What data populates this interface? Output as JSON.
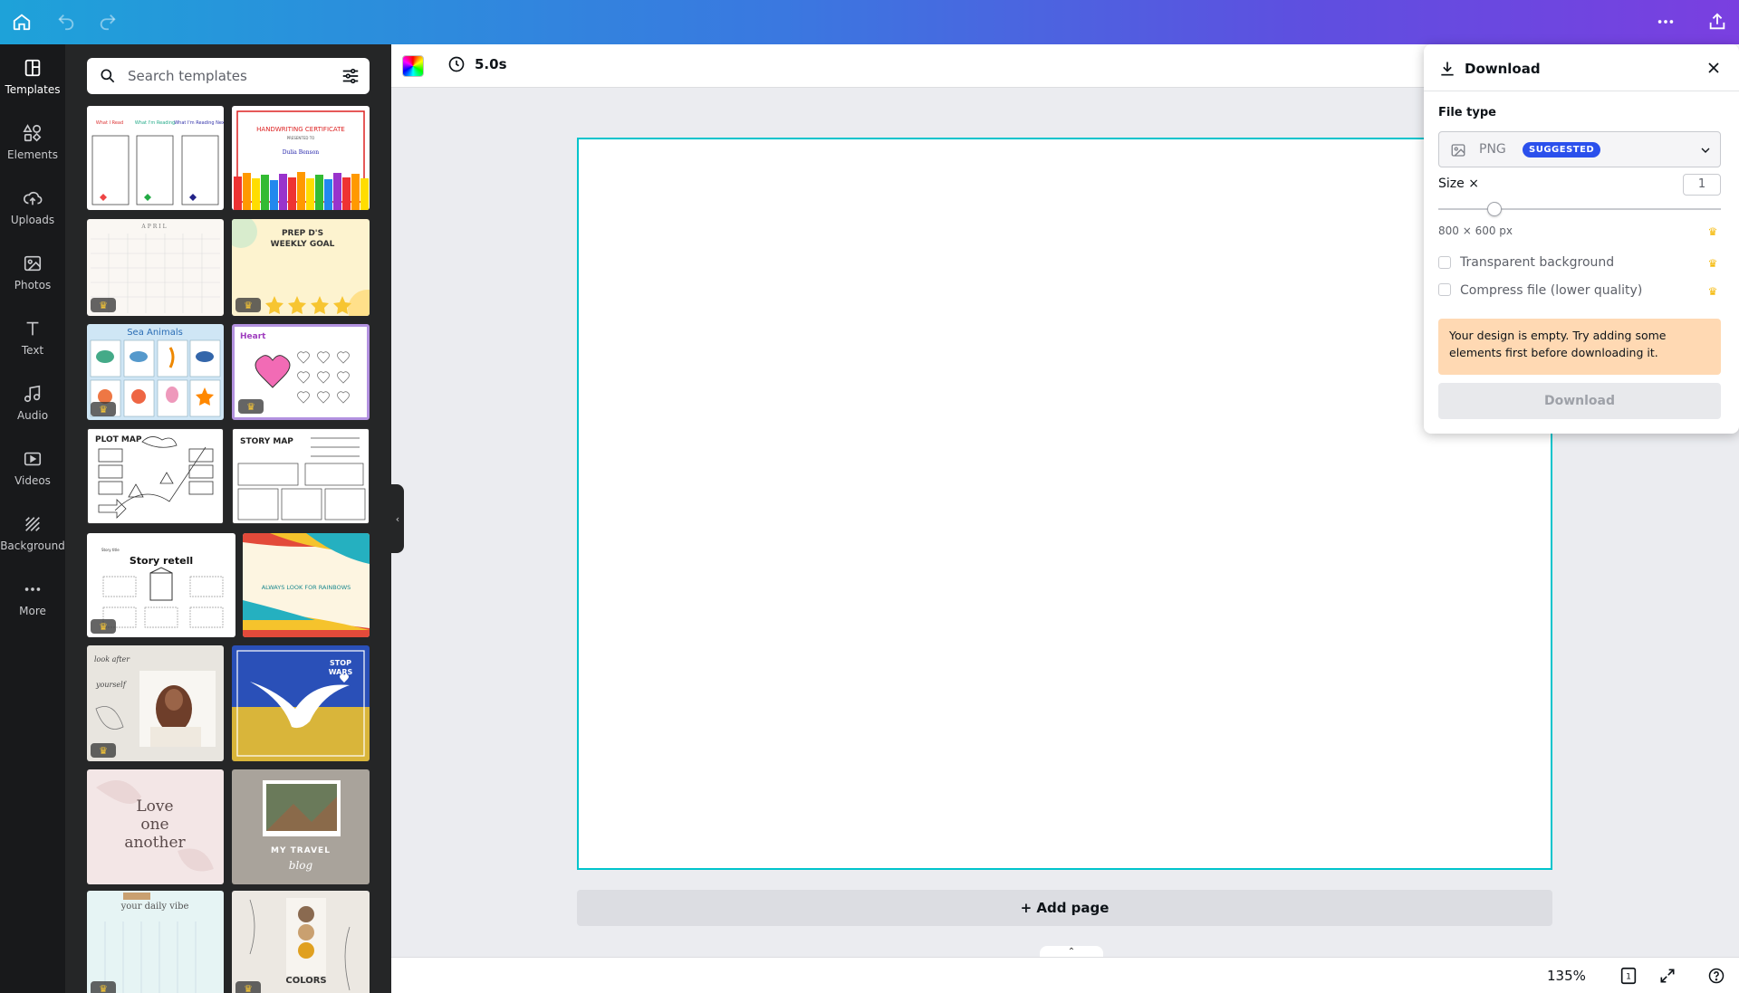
{
  "topbar": {
    "home_icon": "home-icon",
    "undo_icon": "undo-icon",
    "redo_icon": "redo-icon",
    "more_icon": "more-dots-icon",
    "share_icon": "share-export-icon"
  },
  "rail": {
    "items": [
      {
        "label": "Templates",
        "icon": "templates-icon",
        "active": true
      },
      {
        "label": "Elements",
        "icon": "elements-icon"
      },
      {
        "label": "Uploads",
        "icon": "upload-cloud-icon"
      },
      {
        "label": "Photos",
        "icon": "photos-icon"
      },
      {
        "label": "Text",
        "icon": "text-icon"
      },
      {
        "label": "Audio",
        "icon": "music-note-icon"
      },
      {
        "label": "Videos",
        "icon": "video-icon"
      },
      {
        "label": "Background",
        "icon": "background-pattern-icon"
      },
      {
        "label": "More",
        "icon": "more-dots-icon"
      }
    ]
  },
  "panel": {
    "search_placeholder": "Search templates",
    "templates": [
      {
        "name": "reading-log"
      },
      {
        "name": "handwriting-certificate",
        "text": "HANDWRITING CERTIFICATE"
      },
      {
        "name": "april-calendar",
        "text": "APRIL",
        "premium": true
      },
      {
        "name": "weekly-goal",
        "text": "PREP D'S WEEKLY GOAL",
        "premium": true
      },
      {
        "name": "sea-animals",
        "text": "Sea Animals",
        "premium": true
      },
      {
        "name": "heart-worksheet",
        "text": "Heart",
        "premium": true
      },
      {
        "name": "plot-map",
        "text": "PLOT MAP"
      },
      {
        "name": "story-map",
        "text": "STORY MAP"
      },
      {
        "name": "story-retell",
        "text": "Story retell",
        "premium": true
      },
      {
        "name": "rainbow",
        "text": "ALWAYS LOOK FOR RAINBOWS"
      },
      {
        "name": "look-after-yourself",
        "text": "look after yourself",
        "premium": true
      },
      {
        "name": "stop-wars",
        "text": "STOP WARS"
      },
      {
        "name": "love-one-another",
        "text": "Love one another"
      },
      {
        "name": "travel-blog",
        "text": "MY TRAVEL blog"
      },
      {
        "name": "daily-vibe",
        "text": "your daily vibe",
        "premium": true
      },
      {
        "name": "colors",
        "text": "COLORS",
        "premium": true
      }
    ],
    "crown_glyph": "♛"
  },
  "toolbar": {
    "duration": "5.0s"
  },
  "canvas": {
    "add_page": "+ Add page"
  },
  "status": {
    "zoom": "135%",
    "page_count": "1"
  },
  "download": {
    "title": "Download",
    "file_type_label": "File type",
    "file_type_value": "PNG",
    "file_type_badge": "SUGGESTED",
    "size_label": "Size ×",
    "size_value": "1",
    "size_fraction": 0.2,
    "dimensions": "800 × 600 px",
    "option_transparent": "Transparent background",
    "option_compress": "Compress file (lower quality)",
    "warning": "Your design is empty. Try adding some elements first before downloading it.",
    "button": "Download"
  },
  "colors": {
    "accent_cyan": "#00c4cc",
    "badge_blue": "#2b50ec",
    "warning_bg": "#ffd9b3",
    "crown_gold": "#f5b700"
  }
}
